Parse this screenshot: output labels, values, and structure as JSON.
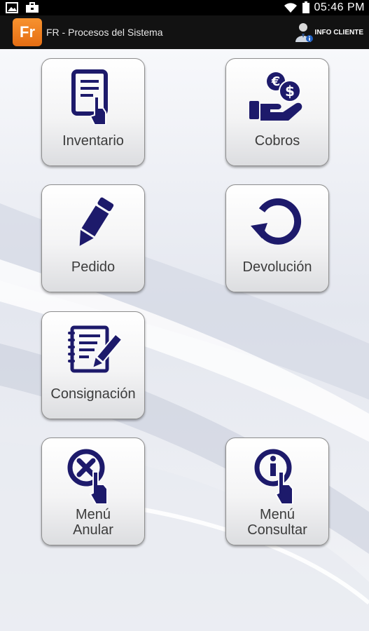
{
  "status_bar": {
    "time": "05:46 PM",
    "left_icons": [
      "gallery-icon",
      "briefcase-icon"
    ],
    "right_icons": [
      "wifi-icon",
      "battery-icon"
    ]
  },
  "action_bar": {
    "logo_text": "Fr",
    "title": "FR - Procesos del Sistema",
    "info_cliente_label": "INFO CLIENTE",
    "info_cliente_icon": "user-info-icon"
  },
  "tiles": [
    {
      "id": "inventario",
      "label": "Inventario",
      "icon": "tablet-touch-icon"
    },
    {
      "id": "cobros",
      "label": "Cobros",
      "icon": "money-hand-icon"
    },
    {
      "id": "pedido",
      "label": "Pedido",
      "icon": "pencil-icon"
    },
    {
      "id": "devolucion",
      "label": "Devolución",
      "icon": "return-arrow-icon"
    },
    {
      "id": "consignacion",
      "label": "Consignación",
      "icon": "notepad-pen-icon"
    },
    {
      "id": "menu_anular",
      "label_line1": "Menú",
      "label_line2": "Anular",
      "icon": "cancel-touch-icon"
    },
    {
      "id": "menu_consultar",
      "label_line1": "Menú",
      "label_line2": "Consultar",
      "icon": "info-touch-icon"
    }
  ],
  "colors": {
    "icon_navy": "#1d1a6b",
    "tile_label": "#3c3c3c",
    "logo_orange": "#ef7f22",
    "action_bar": "#121212"
  }
}
